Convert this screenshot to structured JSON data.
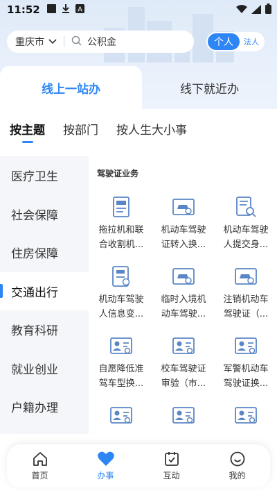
{
  "status_bar": {
    "time": "11:52",
    "left_icons": [
      "square-icon",
      "download-icon",
      "a-icon"
    ],
    "right_icons": [
      "wifi-icon",
      "signal-icon",
      "battery-icon"
    ]
  },
  "search": {
    "city": "重庆市",
    "placeholder": "公积金"
  },
  "user_toggle": {
    "personal": "个人",
    "legal": "法人"
  },
  "top_tabs": [
    {
      "label": "线上一站办",
      "active": true
    },
    {
      "label": "线下就近办",
      "active": false
    }
  ],
  "sub_tabs": [
    {
      "label": "按主题",
      "active": true
    },
    {
      "label": "按部门",
      "active": false
    },
    {
      "label": "按人生大小事",
      "active": false
    }
  ],
  "categories": [
    {
      "label": "医疗卫生",
      "active": false
    },
    {
      "label": "社会保障",
      "active": false
    },
    {
      "label": "住房保障",
      "active": false
    },
    {
      "label": "交通出行",
      "active": true
    },
    {
      "label": "教育科研",
      "active": false
    },
    {
      "label": "就业创业",
      "active": false
    },
    {
      "label": "户籍办理",
      "active": false
    }
  ],
  "section_title": "驾驶证业务",
  "services": [
    {
      "label": "拖拉机和联\n合收割机...",
      "icon": "doc-card-icon"
    },
    {
      "label": "机动车驾驶\n证转入换...",
      "icon": "car-card-icon"
    },
    {
      "label": "机动车驾驶\n人提交身...",
      "icon": "doc-search-icon"
    },
    {
      "label": "机动车驾驶\n人信息变...",
      "icon": "doc-edit-icon"
    },
    {
      "label": "临时入境机\n动车驾驶...",
      "icon": "car-card-icon"
    },
    {
      "label": "注销机动车\n驾驶证（...",
      "icon": "car-card-icon"
    },
    {
      "label": "自愿降低准\n驾车型换...",
      "icon": "id-card-icon"
    },
    {
      "label": "校车驾驶证\n审验（市...",
      "icon": "id-card-icon"
    },
    {
      "label": "军警机动车\n驾驶证换...",
      "icon": "id-card-icon"
    },
    {
      "label": "",
      "icon": "id-card-icon"
    },
    {
      "label": "",
      "icon": "id-card-icon"
    },
    {
      "label": "",
      "icon": "id-card-icon"
    }
  ],
  "bottom_nav": [
    {
      "label": "首页",
      "icon": "home-icon",
      "active": false
    },
    {
      "label": "办事",
      "icon": "heart-icon",
      "active": true
    },
    {
      "label": "互动",
      "icon": "calendar-check-icon",
      "active": false
    },
    {
      "label": "我的",
      "icon": "smile-icon",
      "active": false
    }
  ],
  "colors": {
    "accent": "#2e86f5",
    "icon_blue": "#5b86c5",
    "nav_bg": "#f4f6f9"
  }
}
